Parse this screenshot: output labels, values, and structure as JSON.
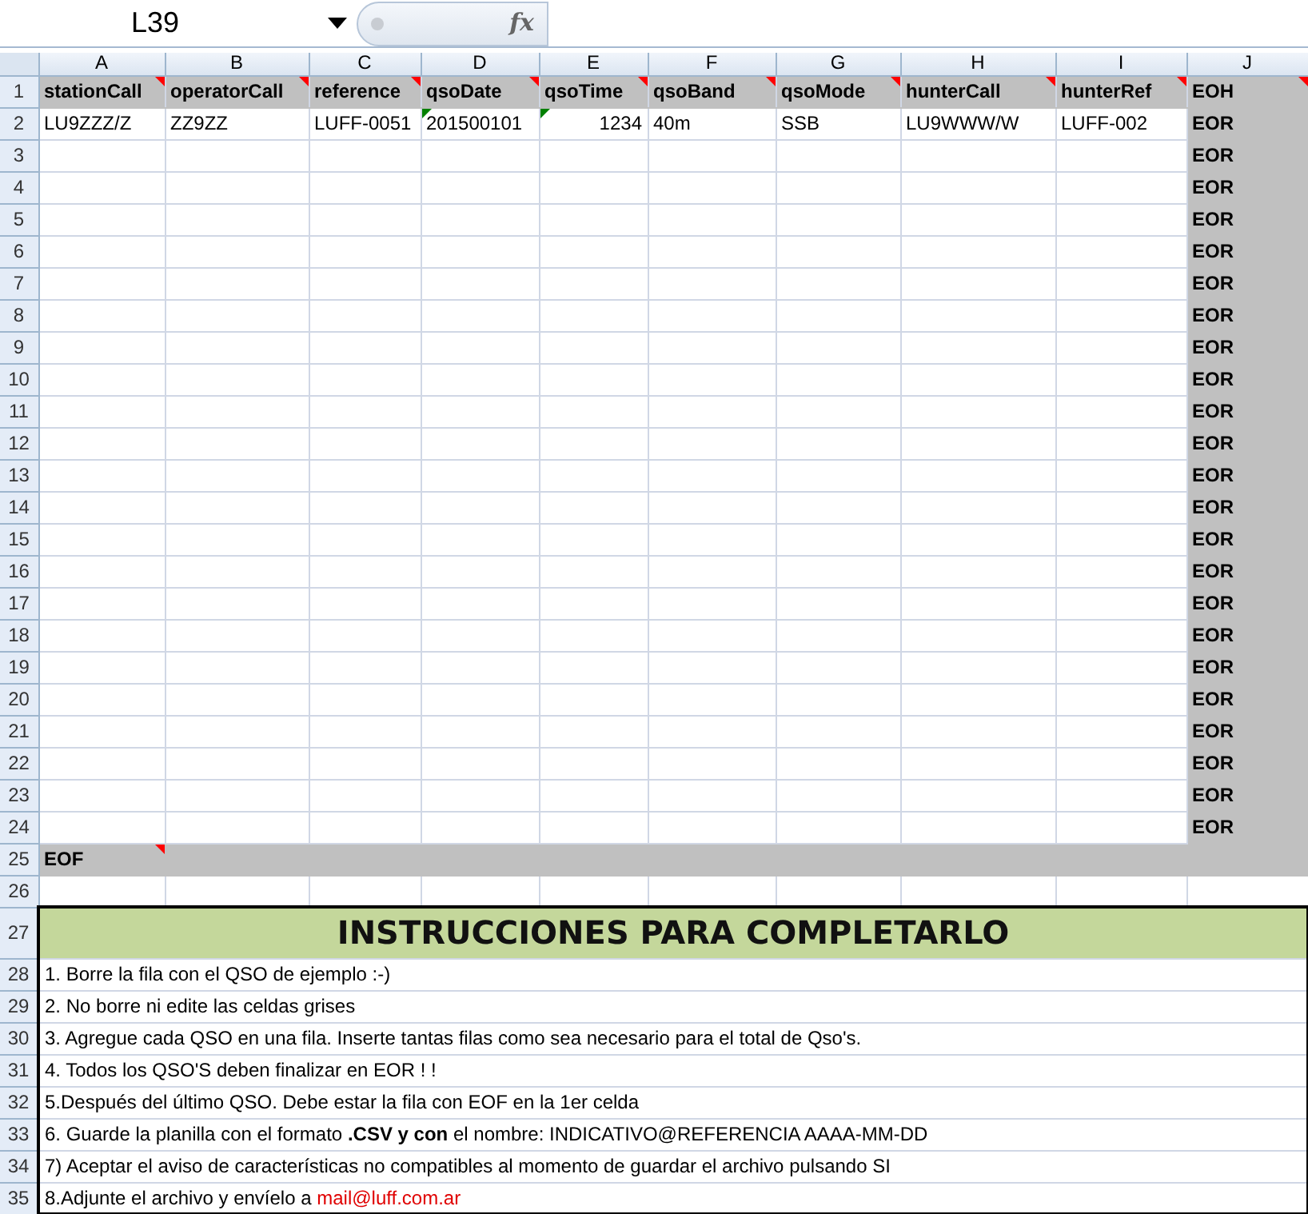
{
  "name_box": "L39",
  "function_label": "fx",
  "columns": [
    "A",
    "B",
    "C",
    "D",
    "E",
    "F",
    "G",
    "H",
    "I",
    "J"
  ],
  "rows": [
    {
      "number": "1",
      "kind": "header",
      "cells": [
        {
          "text": "stationCall",
          "comment": true
        },
        {
          "text": "operatorCall",
          "comment": true
        },
        {
          "text": "reference",
          "comment": true
        },
        {
          "text": "qsoDate",
          "comment": true
        },
        {
          "text": "qsoTime",
          "comment": true
        },
        {
          "text": "qsoBand",
          "comment": true
        },
        {
          "text": "qsoMode",
          "comment": true
        },
        {
          "text": "hunterCall",
          "comment": true
        },
        {
          "text": "hunterRef",
          "comment": true
        },
        {
          "text": "EOH",
          "comment": true
        }
      ]
    },
    {
      "number": "2",
      "kind": "data",
      "cells": [
        {
          "text": "LU9ZZZ/Z",
          "kind": "text"
        },
        {
          "text": "ZZ9ZZ",
          "kind": "text"
        },
        {
          "text": "LUFF-0051",
          "kind": "text"
        },
        {
          "text": "201500101",
          "kind": "text",
          "flag": true
        },
        {
          "text": "1234",
          "kind": "number",
          "flag": true
        },
        {
          "text": "40m",
          "kind": "text"
        },
        {
          "text": "SSB",
          "kind": "text"
        },
        {
          "text": "LU9WWW/W",
          "kind": "text"
        },
        {
          "text": "LUFF-002",
          "kind": "text"
        }
      ],
      "end_marker": "EOR"
    },
    {
      "number": "3",
      "kind": "data",
      "end_marker": "EOR"
    },
    {
      "number": "4",
      "kind": "data",
      "end_marker": "EOR"
    },
    {
      "number": "5",
      "kind": "data",
      "end_marker": "EOR"
    },
    {
      "number": "6",
      "kind": "data",
      "end_marker": "EOR"
    },
    {
      "number": "7",
      "kind": "data",
      "end_marker": "EOR"
    },
    {
      "number": "8",
      "kind": "data",
      "end_marker": "EOR"
    },
    {
      "number": "9",
      "kind": "data",
      "end_marker": "EOR"
    },
    {
      "number": "10",
      "kind": "data",
      "end_marker": "EOR"
    },
    {
      "number": "11",
      "kind": "data",
      "end_marker": "EOR"
    },
    {
      "number": "12",
      "kind": "data",
      "end_marker": "EOR"
    },
    {
      "number": "13",
      "kind": "data",
      "end_marker": "EOR"
    },
    {
      "number": "14",
      "kind": "data",
      "end_marker": "EOR"
    },
    {
      "number": "15",
      "kind": "data",
      "end_marker": "EOR"
    },
    {
      "number": "16",
      "kind": "data",
      "end_marker": "EOR"
    },
    {
      "number": "17",
      "kind": "data",
      "end_marker": "EOR"
    },
    {
      "number": "18",
      "kind": "data",
      "end_marker": "EOR"
    },
    {
      "number": "19",
      "kind": "data",
      "end_marker": "EOR"
    },
    {
      "number": "20",
      "kind": "data",
      "end_marker": "EOR"
    },
    {
      "number": "21",
      "kind": "data",
      "end_marker": "EOR"
    },
    {
      "number": "22",
      "kind": "data",
      "end_marker": "EOR"
    },
    {
      "number": "23",
      "kind": "data",
      "end_marker": "EOR"
    },
    {
      "number": "24",
      "kind": "data",
      "end_marker": "EOR"
    },
    {
      "number": "25",
      "kind": "eof",
      "text": "EOF",
      "comment": true
    },
    {
      "number": "26",
      "kind": "blank"
    },
    {
      "number": "27",
      "kind": "title",
      "text": "INSTRUCCIONES PARA COMPLETARLO"
    },
    {
      "number": "28",
      "kind": "instruction",
      "text": "1. Borre la fila con el QSO de ejemplo :-)"
    },
    {
      "number": "29",
      "kind": "instruction",
      "text": "2. No borre ni edite las celdas grises"
    },
    {
      "number": "30",
      "kind": "instruction",
      "text": "3. Agregue cada QSO en una fila. Inserte tantas filas como sea necesario para el total de Qso's."
    },
    {
      "number": "31",
      "kind": "instruction",
      "text": "4. Todos los QSO'S deben finalizar en EOR ! !"
    },
    {
      "number": "32",
      "kind": "instruction",
      "text": "5.Después del último QSO. Debe estar la fila con EOF en la 1er celda"
    },
    {
      "number": "33",
      "kind": "instruction",
      "text": "6. Guarde la planilla con el formato **.CSV y con** el nombre: INDICATIVO@REFERENCIA AAAA-MM-DD"
    },
    {
      "number": "34",
      "kind": "instruction",
      "text": "7) Aceptar el aviso de características no compatibles al momento de guardar el archivo pulsando SI"
    },
    {
      "number": "35",
      "kind": "instruction",
      "text": "8.Adjunte el archivo y envíelo a ",
      "link": "mail@luff.com.ar"
    }
  ]
}
